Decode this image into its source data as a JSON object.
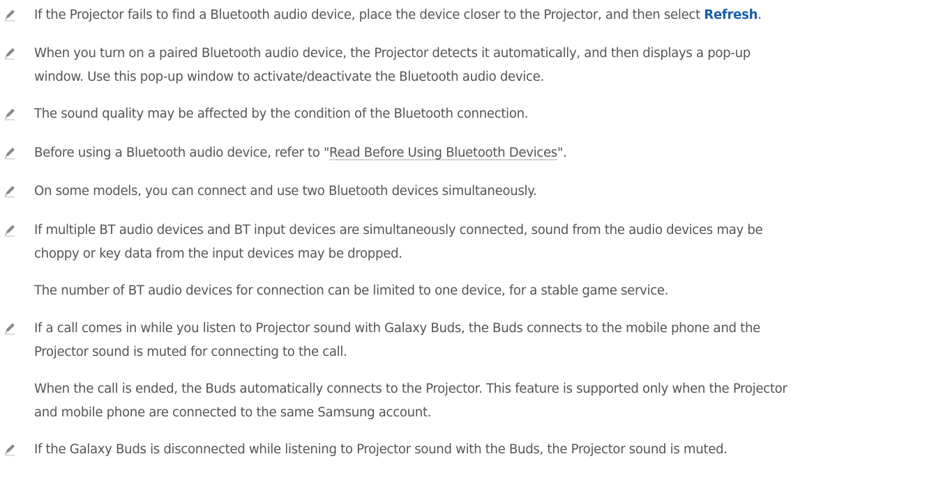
{
  "notes": [
    {
      "pre": "If the Projector fails to find a Bluetooth audio device, place the device closer to the Projector, and then select ",
      "link": "Refresh",
      "post": "."
    },
    {
      "line1": "When you turn on a paired Bluetooth audio device, the Projector detects it automatically, and then displays a pop-up",
      "line2": "window. Use this pop-up window to activate/deactivate the Bluetooth audio device."
    },
    {
      "line1": "The sound quality may be affected by the condition of the Bluetooth connection."
    },
    {
      "pre": "Before using a Bluetooth audio device, refer to \"",
      "link": "Read Before Using Bluetooth Devices",
      "post": "\"."
    },
    {
      "line1": "On some models, you can connect and use two Bluetooth devices simultaneously."
    },
    {
      "line1": "If multiple BT audio devices and BT input devices are simultaneously connected, sound from the audio devices may be",
      "line2": "choppy or key data from the input devices may be dropped.",
      "extra1": "The number of BT audio devices for connection can be limited to one device, for a stable game service."
    },
    {
      "line1": "If a call comes in while you listen to Projector sound with Galaxy Buds, the Buds connects to the mobile phone and the",
      "line2": "Projector sound is muted for connecting to the call.",
      "extra1": "When the call is ended, the Buds automatically connects to the Projector. This feature is supported only when the Projector",
      "extra2": "and mobile phone are connected to the same Samsung account."
    },
    {
      "line1": "If the Galaxy Buds is disconnected while listening to Projector sound with the Buds, the Projector sound is muted."
    }
  ],
  "icon": "pencil-note-icon",
  "colors": {
    "text": "#555555",
    "link": "#1a5fa6",
    "icon": "#8a8a8a"
  }
}
